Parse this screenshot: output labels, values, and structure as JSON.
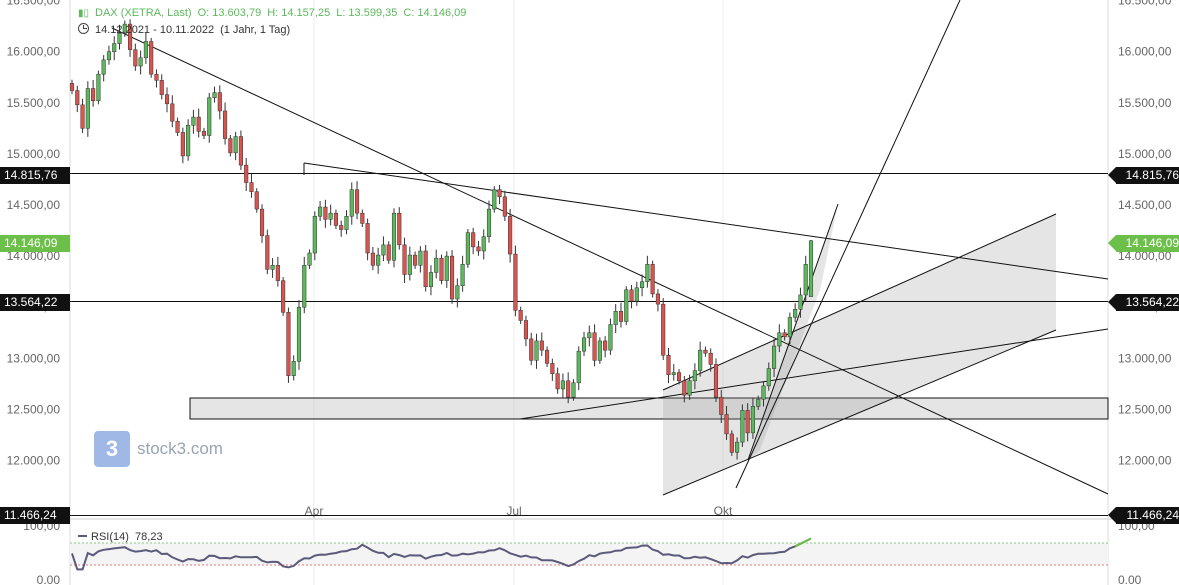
{
  "header": {
    "instrument": "DAX (XETRA, Last)",
    "open": "O: 13.603,79",
    "high": "H: 14.157,25",
    "low": "L: 13.599,35",
    "close": "C: 14.146,09",
    "range": "14.12.2021 - 10.11.2022",
    "interval": "(1 Jahr, 1 Tag)",
    "color": "#5cb85c"
  },
  "price_labels": {
    "top_left": "14.815,76",
    "top_right": "14.815,76",
    "current_left": "14.146,09",
    "current_right": "14.146,09",
    "mid_left": "13.564,22",
    "mid_right": "13.564,22",
    "low_left": "11.466,24",
    "low_right": "11.466,24"
  },
  "logo": {
    "mark": "3",
    "text": "stock3.com"
  },
  "rsi": {
    "label": "RSI(14)",
    "value": "78,23",
    "axis_top": "100,00",
    "axis_bottom": "0.00"
  },
  "chart_data": {
    "type": "candlestick",
    "x_ticks": [
      "Apr",
      "Jul",
      "Okt"
    ],
    "y_ticks": [
      "12.000,00",
      "12.500,00",
      "13.000,00",
      "13.500,00",
      "14.000,00",
      "14.500,00",
      "15.000,00",
      "15.500,00",
      "16.000,00",
      "16.500,00"
    ],
    "y_tick_values": [
      12000,
      12500,
      13000,
      13500,
      14000,
      14500,
      15000,
      15500,
      16000,
      16500
    ],
    "ylim": [
      11466.24,
      16500
    ],
    "horizontal_lines": [
      14815.76,
      13564.22,
      11466.24
    ],
    "colors": {
      "up": "#5cb85c",
      "down": "#d9534f",
      "current": "#6cc04a"
    },
    "closes": [
      15620,
      15480,
      15250,
      15640,
      15520,
      15780,
      15920,
      16000,
      16080,
      16180,
      16270,
      16020,
      15860,
      15940,
      16100,
      15780,
      15720,
      15580,
      15490,
      15320,
      15210,
      14980,
      15280,
      15360,
      15220,
      15180,
      15550,
      15600,
      15420,
      15150,
      15010,
      15170,
      14890,
      14720,
      14630,
      14460,
      14200,
      13870,
      13910,
      13760,
      13450,
      12830,
      12970,
      13500,
      13910,
      14030,
      14390,
      14480,
      14360,
      14420,
      14300,
      14260,
      14390,
      14650,
      14420,
      14320,
      14030,
      13910,
      14010,
      14110,
      13960,
      14420,
      14110,
      13820,
      14010,
      13910,
      14050,
      13700,
      13840,
      13980,
      13760,
      14000,
      13580,
      13710,
      13920,
      14230,
      14090,
      14050,
      14190,
      14460,
      14650,
      14580,
      14390,
      14020,
      13470,
      13370,
      13190,
      12980,
      13170,
      13080,
      12950,
      12850,
      12700,
      12780,
      12620,
      12760,
      13070,
      13200,
      13250,
      12980,
      13170,
      13080,
      13330,
      13460,
      13360,
      13670,
      13560,
      13690,
      13750,
      13920,
      13630,
      13530,
      13030,
      12840,
      12860,
      12780,
      12640,
      12780,
      12880,
      13080,
      13050,
      12940,
      12620,
      12450,
      12260,
      12080,
      12180,
      12490,
      12270,
      12530,
      12600,
      12730,
      12900,
      13120,
      13250,
      13210,
      13400,
      13480,
      13620,
      13920,
      14150
    ]
  }
}
